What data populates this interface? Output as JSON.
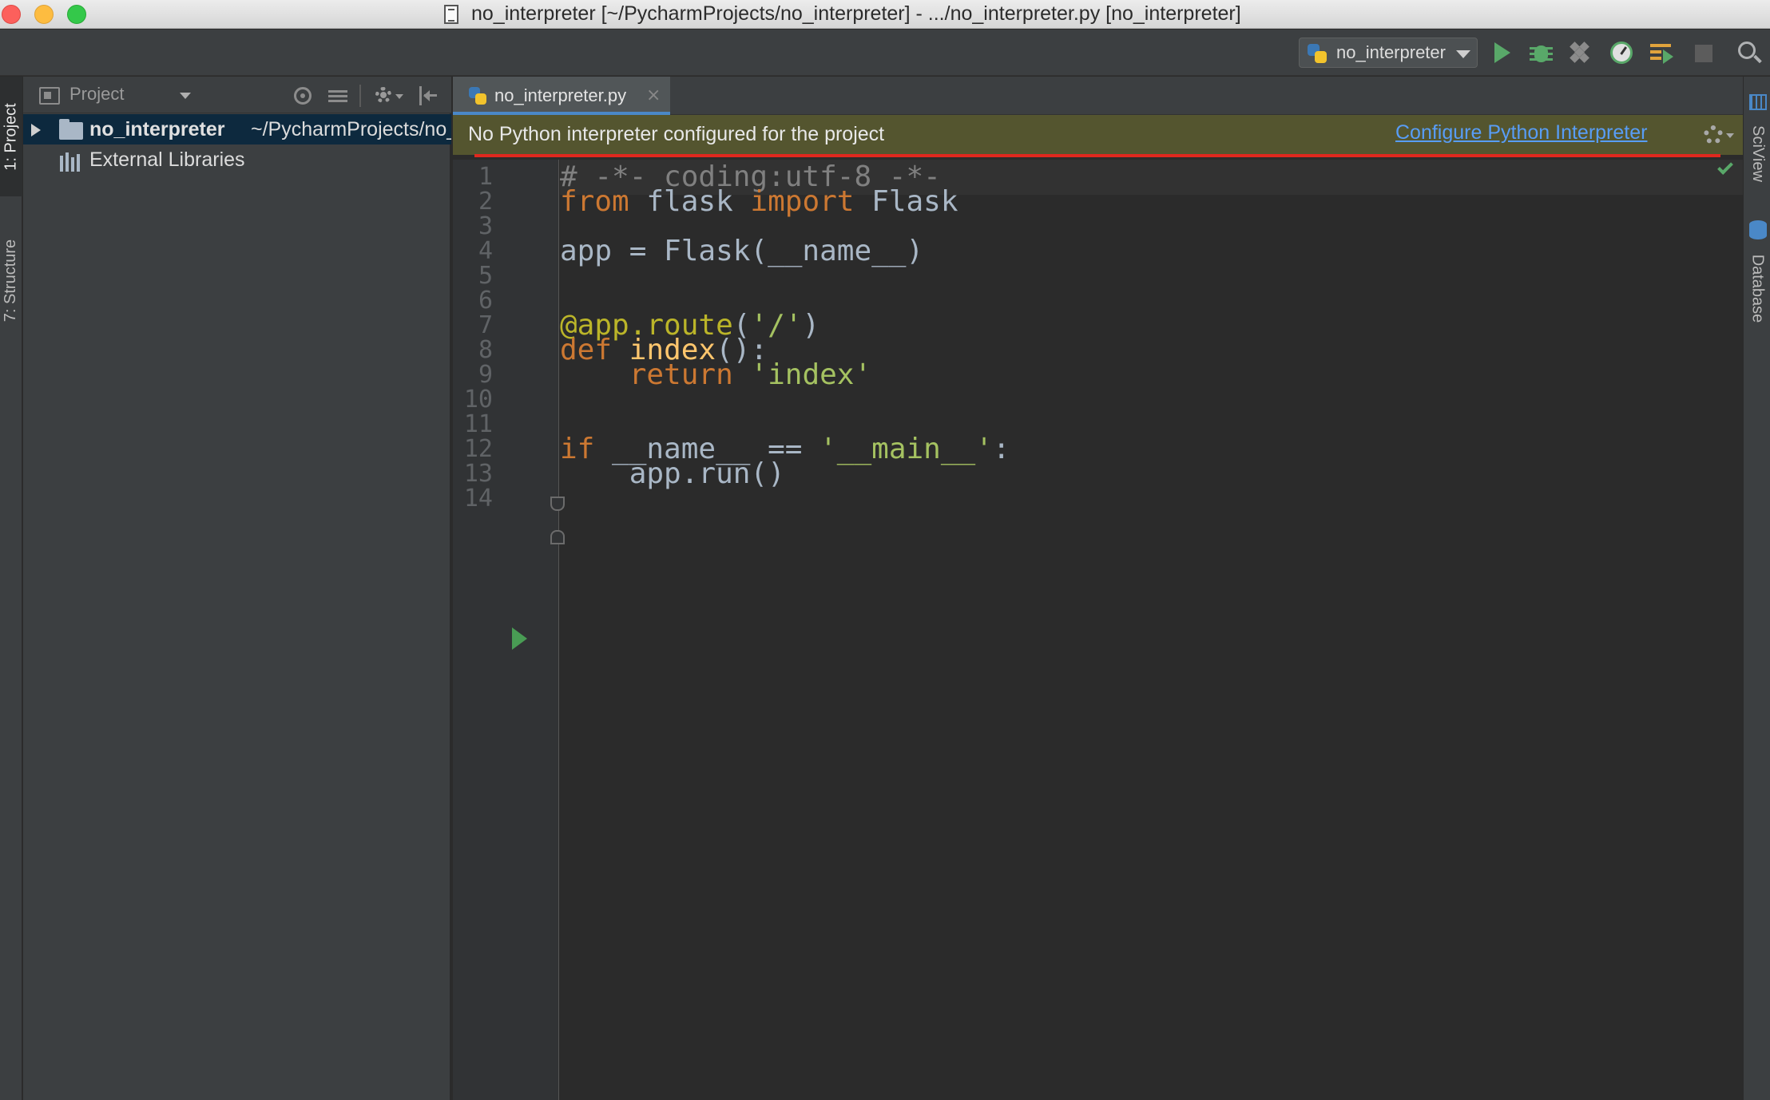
{
  "window": {
    "title": "no_interpreter [~/PycharmProjects/no_interpreter] - .../no_interpreter.py [no_interpreter]"
  },
  "toolbar": {
    "run_config_label": "no_interpreter",
    "icons": [
      "run-icon",
      "debug-icon",
      "coverage-icon",
      "profile-icon",
      "run-list-icon",
      "stop-icon",
      "search-icon"
    ]
  },
  "left_stripe": {
    "project_tab": "1: Project",
    "structure_tab": "7: Structure"
  },
  "project_panel": {
    "title": "Project",
    "tree": {
      "root_name": "no_interpreter",
      "root_path": "~/PycharmProjects/no_interpreter",
      "external_libraries": "External Libraries"
    }
  },
  "editor": {
    "tab_label": "no_interpreter.py",
    "tab_close": "×",
    "banner": {
      "message": "No Python interpreter configured for the project",
      "link": "Configure Python Interpreter"
    },
    "line_numbers": [
      "1",
      "2",
      "3",
      "4",
      "5",
      "6",
      "7",
      "8",
      "9",
      "10",
      "11",
      "12",
      "13",
      "14"
    ],
    "code": {
      "l1_comment": "# -*- coding:utf-8 -*-",
      "l2_from": "from",
      "l2_mod": " flask ",
      "l2_import": "import",
      "l2_name": " Flask",
      "l4": "app = Flask(__name__)",
      "l7_deco": "@app.route",
      "l7_open": "(",
      "l7_str": "'/'",
      "l7_close": ")",
      "l8_def": "def",
      "l8_space": " ",
      "l8_fn": "index",
      "l8_rest": "():",
      "l9_indent": "    ",
      "l9_return": "return",
      "l9_space": " ",
      "l9_str": "'index'",
      "l12_if": "if",
      "l12_mid": " __name__ == ",
      "l12_str": "'__main__'",
      "l12_colon": ":",
      "l13": "    app.run()"
    }
  },
  "right_stripe": {
    "sciview_tab": "SciView",
    "database_tab": "Database"
  },
  "colors": {
    "keyword": "#cc7832",
    "string": "#a5c261",
    "comment": "#808080",
    "decorator": "#bbb529",
    "function": "#ffc66d",
    "banner_bg": "#54552f",
    "link": "#589df6",
    "error_underline": "#e0281e"
  }
}
